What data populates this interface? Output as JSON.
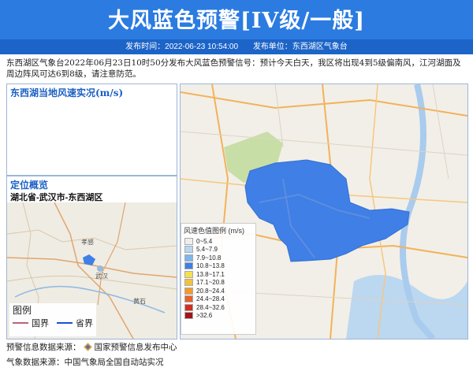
{
  "header": {
    "title": "大风蓝色预警[IV级/一般]",
    "publish_time": "发布时间：2022-06-23 10:54:00",
    "publisher": "发布单位：东西湖区气象台"
  },
  "description": "东西湖区气象台2022年06月23日10时50分发布大风蓝色预警信号：预计今天白天，我区将出现4到5级偏南风，江河湖面及周边阵风可达6到8级，请注意防范。",
  "wind_panel": {
    "title": "东西湖当地风速实况(m/s)"
  },
  "location_panel": {
    "title": "定位概览",
    "subtitle": "湖北省-武汉市-东西湖区"
  },
  "map": {
    "legend_title": "风速色值图例 (m/s)",
    "legend_items": [
      {
        "label": "0~5.4",
        "color": "#eeeeee"
      },
      {
        "label": "5.4~7.9",
        "color": "#b6d8f2"
      },
      {
        "label": "7.9~10.8",
        "color": "#7db6ef"
      },
      {
        "label": "10.8~13.8",
        "color": "#3f7fe6"
      },
      {
        "label": "13.8~17.1",
        "color": "#f5e04a"
      },
      {
        "label": "17.1~20.8",
        "color": "#f4c237"
      },
      {
        "label": "20.8~24.4",
        "color": "#f29a2c"
      },
      {
        "label": "24.4~28.4",
        "color": "#e8622a"
      },
      {
        "label": "28.4~32.6",
        "color": "#d22f22"
      },
      {
        "label": ">32.6",
        "color": "#a0141a"
      }
    ],
    "area_color": "#3f7fe6"
  },
  "mini_map": {
    "legend_title": "图例",
    "legend_items": [
      {
        "label": "国界",
        "color": "#c0607a"
      },
      {
        "label": "省界",
        "color": "#1d4fd6"
      }
    ],
    "place_labels": [
      "孝感",
      "武汉",
      "黄石"
    ]
  },
  "footer": {
    "warning_source_label": "预警信息数据来源：",
    "warning_source": "国家预警信息发布中心",
    "weather_source": "气象数据来源：中国气象局全国自动站实况"
  }
}
